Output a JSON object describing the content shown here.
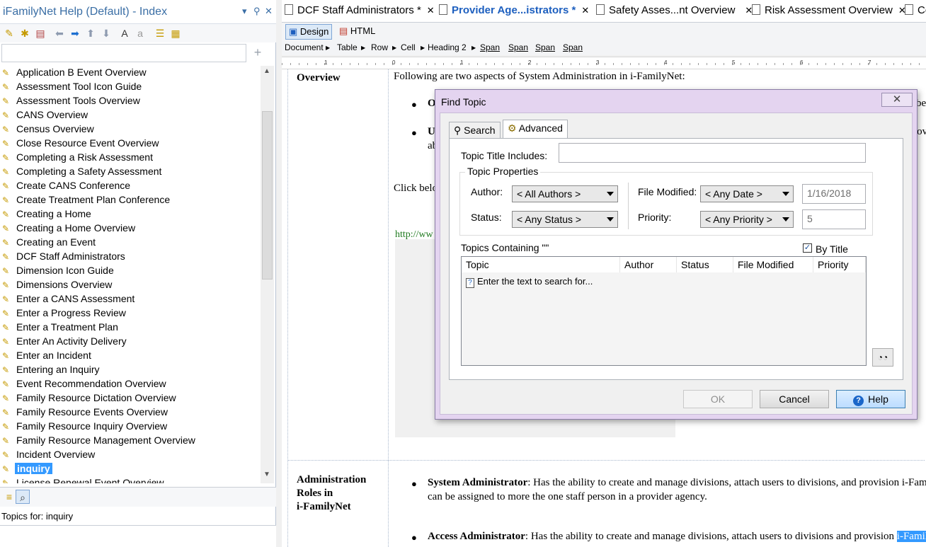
{
  "left_pane": {
    "title": "iFamilyNet Help (Default) - Index",
    "pin_glyph": "▾",
    "pin2_glyph": "⚲",
    "close_glyph": "✕",
    "search_value": "",
    "add_glyph": "+",
    "items": [
      "Application B Event Overview",
      "Assessment Tool Icon Guide",
      "Assessment Tools Overview",
      "CANS Overview",
      "Census Overview",
      "Close Resource Event Overview",
      "Completing a Risk Assessment",
      "Completing a Safety Assessment",
      "Create CANS Conference",
      "Create Treatment Plan Conference",
      "Creating a Home",
      "Creating a Home Overview",
      "Creating an Event",
      "DCF Staff Administrators",
      "Dimension Icon Guide",
      "Dimensions Overview",
      "Enter a CANS Assessment",
      "Enter a Progress Review",
      "Enter a Treatment Plan",
      "Enter An Activity Delivery",
      "Enter an Incident",
      "Entering an Inquiry",
      "Event Recommendation Overview",
      "Family Resource Dictation Overview",
      "Family Resource Events Overview",
      "Family Resource Inquiry Overview",
      "Family Resource Management Overview",
      "Incident Overview",
      "inquiry",
      "License Renewal Event Overview"
    ],
    "selected_item": "inquiry",
    "topics_for": "Topics for: inquiry"
  },
  "tabs": [
    {
      "label": "DCF Staff Administrators *",
      "close": "✕"
    },
    {
      "label": "Provider Age...istrators *",
      "close": "✕"
    },
    {
      "label": "Safety Asses...nt Overview",
      "close": "✕"
    },
    {
      "label": "Risk Assessment Overview",
      "close": "✕"
    },
    {
      "label": "Co",
      "close": ""
    }
  ],
  "editor": {
    "modes": {
      "design": "Design",
      "html": "HTML"
    },
    "breadcrumb": [
      "Document",
      "Table",
      "Row",
      "Cell",
      "Heading 2",
      "Span",
      "Span",
      "Span",
      "Span"
    ],
    "ruler_numbers": [
      "1",
      "0",
      "1",
      "2",
      "3",
      "4",
      "5",
      "6",
      "7"
    ],
    "doc": {
      "overview_heading": "Overview",
      "intro": "Following are two aspects of System Administration in i-FamilyNet:",
      "bullet1_start": "O",
      "bullet1_end": "be",
      "bullet2_start": "U",
      "bullet2_line2": "ab",
      "bullet2_end": "lov",
      "click_below": "Click belo",
      "link": "http://ww",
      "admin_heading_1": "Administration",
      "admin_heading_2": "Roles in",
      "admin_heading_3": "i-FamilyNet",
      "sys_admin_term": "System Administrator",
      "sys_admin_text": ": Has the ability to create and manage divisions, attach users to divisions, and provision i-Fam",
      "sys_admin_line2": "can be assigned to more the one staff person in a provider agency.",
      "access_admin_term": "Access Administrator",
      "access_admin_text": ": Has the ability to create and manage divisions, attach users to divisions and provision",
      "access_admin_hl": "i-Famil"
    }
  },
  "dialog": {
    "title": "Find Topic",
    "close_glyph": "✕",
    "tabs": {
      "search": "Search",
      "advanced": "Advanced"
    },
    "topic_title_label": "Topic Title Includes:",
    "topic_title_value": "",
    "group_title": "Topic Properties",
    "author_label": "Author:",
    "author_value": "< All Authors >",
    "status_label": "Status:",
    "status_value": "< Any Status >",
    "file_modified_label": "File Modified:",
    "file_modified_value": "< Any Date >",
    "date_value": "1/16/2018",
    "priority_label": "Priority:",
    "priority_value": "< Any Priority >",
    "priority_number": "5",
    "topics_containing": "Topics Containing \"\"",
    "by_title_label": "By Title",
    "by_title_checked": "✓",
    "columns": [
      "Topic",
      "Author",
      "Status",
      "File Modified",
      "Priority"
    ],
    "placeholder_row": "Enter the text to search for...",
    "buttons": {
      "ok": "OK",
      "cancel": "Cancel",
      "help": "Help"
    }
  },
  "colors": {
    "accent": "#1d5fbf",
    "selection": "#3399ff",
    "dialog_frame": "#e4d4f0"
  }
}
